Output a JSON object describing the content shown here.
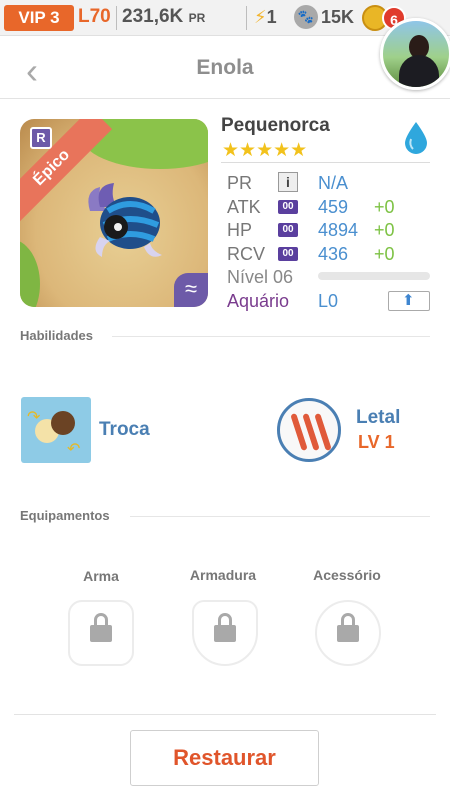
{
  "status_bar": {
    "vip": "VIP 3",
    "level": "L70",
    "coins": "231,6K",
    "coins_unit": "PR",
    "energy": "1",
    "paws": "15K",
    "notifications": "6"
  },
  "header": {
    "title": "Enola"
  },
  "creature": {
    "rarity_badge": "R",
    "rarity": "Épico",
    "name": "Pequenorca",
    "stars": "★★★★★",
    "stats": {
      "pr_label": "PR",
      "pr_value": "N/A",
      "atk_label": "ATK",
      "atk_value": "459",
      "atk_bonus": "+0",
      "hp_label": "HP",
      "hp_value": "4894",
      "hp_bonus": "+0",
      "rcv_label": "RCV",
      "rcv_value": "436",
      "rcv_bonus": "+0",
      "badge": "00",
      "level_label": "Nível 06",
      "level_progress": 0,
      "aquarium_label": "Aquário",
      "aquarium_value": "L0"
    }
  },
  "abilities": {
    "heading": "Habilidades",
    "skills": [
      {
        "name": "Troca"
      },
      {
        "name": "Letal",
        "level": "LV 1"
      }
    ]
  },
  "equipment": {
    "heading": "Equipamentos",
    "slots": [
      {
        "label": "Arma"
      },
      {
        "label": "Armadura"
      },
      {
        "label": "Acessório"
      }
    ]
  },
  "actions": {
    "restore": "Restaurar"
  },
  "colors": {
    "accent_orange": "#e8672a",
    "blue_value": "#4a8fcf",
    "green_bonus": "#7dc244",
    "purple": "#6d5aa8"
  }
}
